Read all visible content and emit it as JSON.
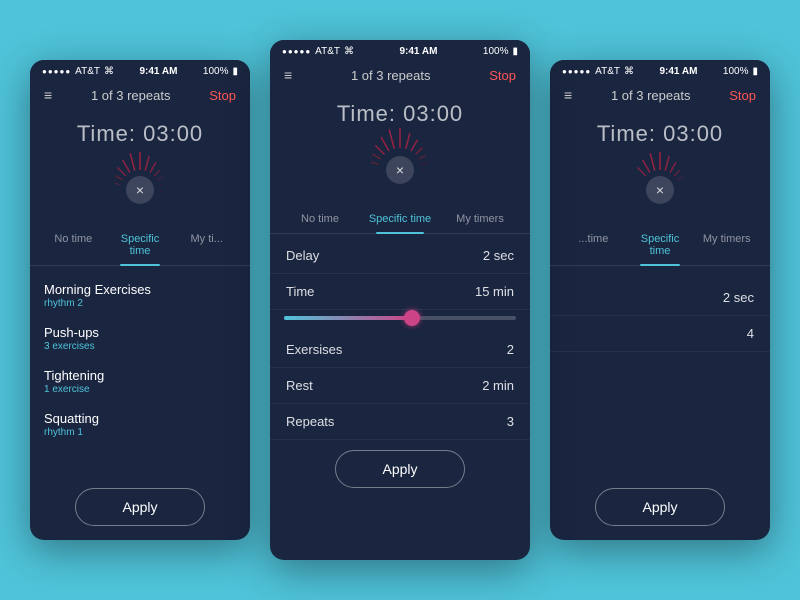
{
  "bg_color": "#4fc3d9",
  "cards": {
    "left": {
      "status": {
        "carrier": "AT&T",
        "wifi": "wifi",
        "time": "9:41 AM",
        "battery": "100%"
      },
      "nav": {
        "title": "1 of 3 repeats",
        "stop": "Stop"
      },
      "timer": "Time: 03:00",
      "tabs": [
        "No time",
        "Specific time",
        "My ti..."
      ],
      "active_tab": 1,
      "list": [
        {
          "name": "Morning Exercises",
          "sub": "rhythm 2"
        },
        {
          "name": "Push-ups",
          "sub": "3 exercises"
        },
        {
          "name": "Tightening",
          "sub": "1 exercise"
        },
        {
          "name": "Squatting",
          "sub": "rhythm 1"
        }
      ],
      "apply_label": "Apply"
    },
    "center": {
      "status": {
        "carrier": "AT&T",
        "wifi": "wifi",
        "time": "9:41 AM",
        "battery": "100%"
      },
      "nav": {
        "title": "1 of 3 repeats",
        "stop": "Stop"
      },
      "timer": "Time: 03:00",
      "tabs": [
        "No time",
        "Specific time",
        "My timers"
      ],
      "active_tab": 1,
      "settings": [
        {
          "label": "Delay",
          "value": "2 sec"
        },
        {
          "label": "Time",
          "value": "15 min"
        },
        {
          "label": "Exersises",
          "value": "2"
        },
        {
          "label": "Rest",
          "value": "2 min"
        },
        {
          "label": "Repeats",
          "value": "3"
        }
      ],
      "slider_fill_pct": 55,
      "apply_label": "Apply"
    },
    "right": {
      "status": {
        "carrier": "AT&T",
        "wifi": "wifi",
        "time": "9:41 AM",
        "battery": "100%"
      },
      "nav": {
        "title": "1 of 3 repeats",
        "stop": "Stop"
      },
      "timer": "Time: 03:00",
      "tabs": [
        "..time",
        "Specific time",
        "My timers"
      ],
      "active_tab": 1,
      "settings_partial": [
        {
          "label": "",
          "value": "2 sec"
        },
        {
          "label": "",
          "value": "4"
        }
      ],
      "apply_label": "Apply"
    }
  },
  "radial_line_count": 24,
  "icons": {
    "hamburger": "≡",
    "close": "×"
  }
}
